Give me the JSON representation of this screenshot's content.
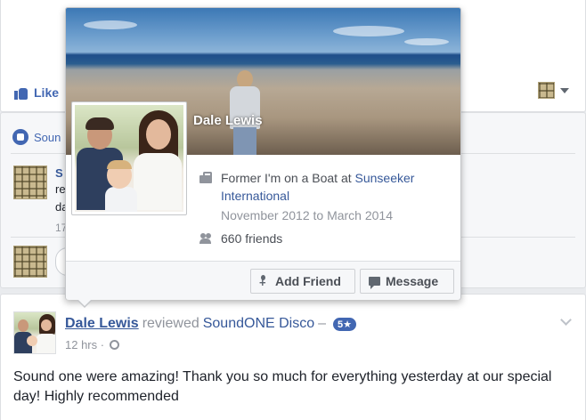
{
  "background_feed": {
    "like_label": "Like",
    "sound_fragment": "Soun",
    "mid_fragments": {
      "s": "S",
      "re": "re",
      "da": "da",
      "num": "17"
    }
  },
  "hovercard": {
    "name": "Dale Lewis",
    "work": {
      "prefix": "Former I'm on a Boat at",
      "company": "Sunseeker International",
      "dates": "November 2012 to March 2014"
    },
    "friends": "660 friends",
    "buttons": {
      "add_friend": "Add Friend",
      "message": "Message"
    }
  },
  "post": {
    "author": "Dale Lewis",
    "action": "reviewed",
    "page": "SoundONE Disco",
    "dash": "–",
    "rating": "5★",
    "time": "12 hrs ·",
    "body": "Sound one were amazing! Thank you so much for everything yesterday at our special day! Highly recommended"
  },
  "colors": {
    "link": "#365899",
    "accent": "#4267b2",
    "muted": "#90949c"
  }
}
